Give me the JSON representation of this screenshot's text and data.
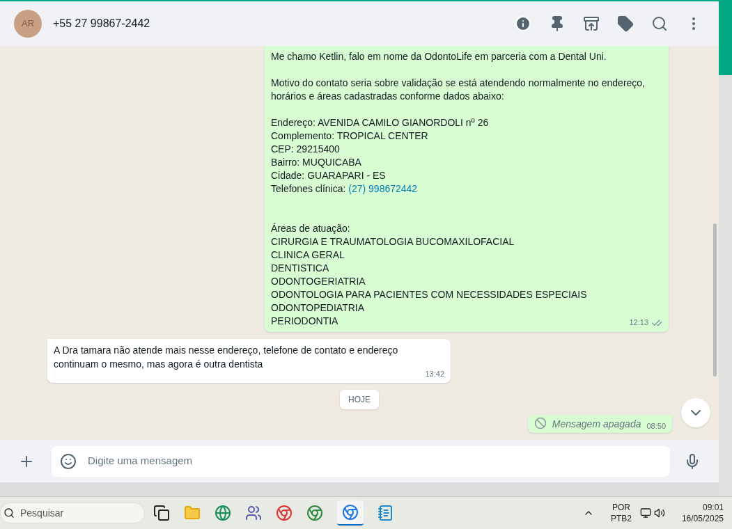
{
  "header": {
    "contact": "+55 27 99867-2442",
    "avatar_initials": "AR"
  },
  "messages": [
    {
      "kind": "outgoing",
      "time": "12:13",
      "paragraphs": [
        {
          "wide_gap": false,
          "lines": [
            {
              "text": "Me chamo Ketlin, falo em nome da OdontoLife em parceria com a Dental Uni."
            }
          ]
        },
        {
          "wide_gap": false,
          "lines": [
            {
              "text": "Motivo do contato seria sobre validação se está atendendo normalmente no endereço,"
            },
            {
              "text": "horários e áreas cadastradas conforme dados abaixo:"
            }
          ]
        },
        {
          "wide_gap": false,
          "lines": [
            {
              "text": "Endereço: AVENIDA CAMILO GIANORDOLI nº 26"
            },
            {
              "text": "Complemento: TROPICAL CENTER"
            },
            {
              "text": "CEP: 29215400"
            },
            {
              "text": "Bairro: MUQUICABA"
            },
            {
              "text": "Cidade: GUARAPARI - ES"
            },
            {
              "text": "Telefones clínica: ",
              "link": "(27) 998672442"
            }
          ]
        },
        {
          "wide_gap": true,
          "lines": [
            {
              "text": "Áreas de atuação:"
            },
            {
              "text": "CIRURGIA E TRAUMATOLOGIA BUCOMAXILOFACIAL"
            },
            {
              "text": "CLINICA GERAL"
            },
            {
              "text": "DENTISTICA"
            },
            {
              "text": "ODONTOGERIATRIA"
            },
            {
              "text": "ODONTOLOGIA PARA PACIENTES COM NECESSIDADES ESPECIAIS"
            },
            {
              "text": "ODONTOPEDIATRIA"
            },
            {
              "text": "PERIODONTIA"
            }
          ]
        }
      ]
    },
    {
      "kind": "incoming",
      "time": "13:42",
      "text": "A Dra tamara não atende mais nesse endereço, telefone de contato e endereço continuam o mesmo, mas agora é outra dentista"
    },
    {
      "kind": "date",
      "text": "HOJE"
    },
    {
      "kind": "deleted",
      "time": "08:50",
      "text": "Mensagem apagada"
    }
  ],
  "composer": {
    "placeholder": "Digite uma mensagem"
  },
  "taskbar": {
    "search_placeholder": "Pesquisar",
    "language": "POR",
    "layout": "PTB2",
    "time": "09:01",
    "date": "16/05/2025"
  }
}
